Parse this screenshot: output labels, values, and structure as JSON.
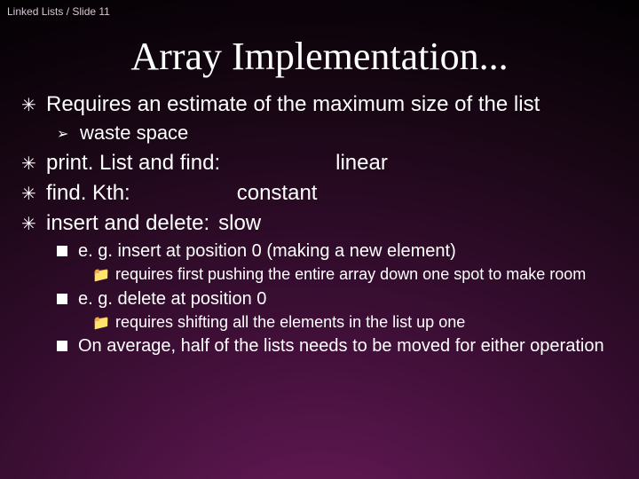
{
  "header": {
    "breadcrumb": "Linked Lists / Slide 11",
    "title": "Array Implementation..."
  },
  "bullets": {
    "b1": "Requires an estimate of the maximum size of the list",
    "b1a": "waste space",
    "b2_label": "print. List and find:",
    "b2_value": "linear",
    "b3_label": "find. Kth:",
    "b3_value": "constant",
    "b4_label": "insert and delete:",
    "b4_value": "slow",
    "b4_n1": "e. g. insert at position 0 (making a new element)",
    "b4_n1a": "requires first pushing the entire array down one spot to make room",
    "b4_n2": "e. g. delete at position 0",
    "b4_n2a": "requires shifting all the elements in the list up one",
    "b4_n3": "On average, half of the lists needs to be moved for either operation"
  }
}
